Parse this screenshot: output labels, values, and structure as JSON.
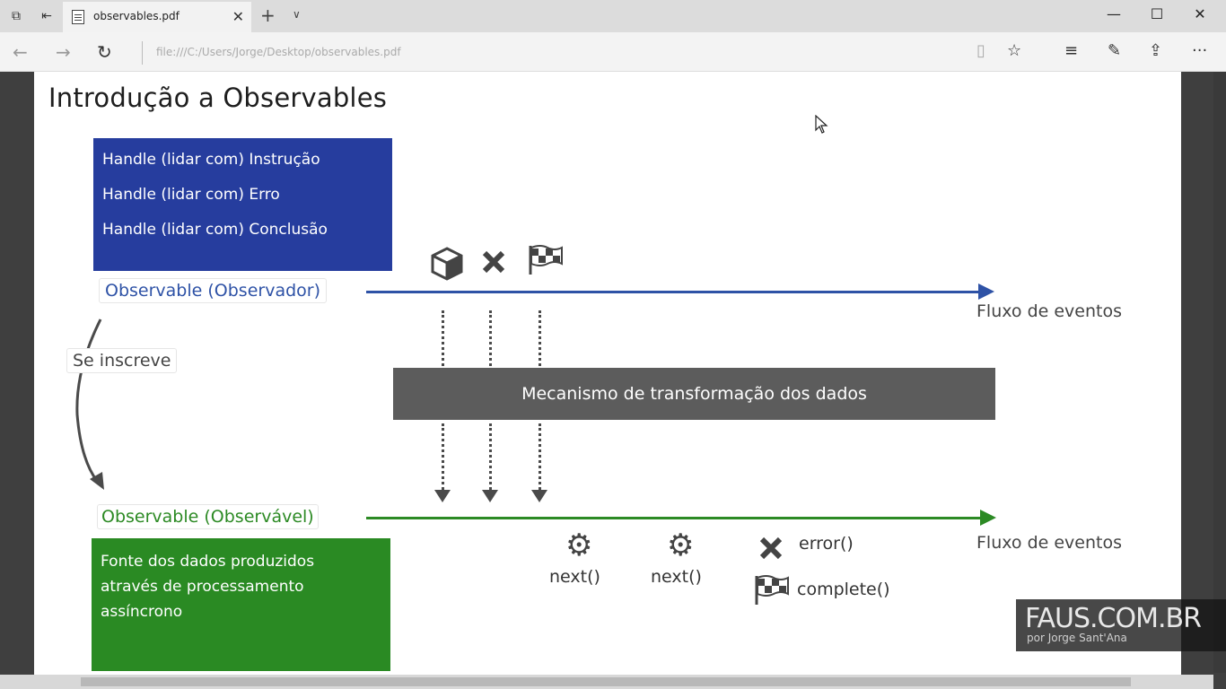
{
  "browser": {
    "tab_title": "observables.pdf",
    "tab_close": "✕",
    "new_tab": "+",
    "tab_list": "∨",
    "url": "file:///C:/Users/Jorge/Desktop/observables.pdf",
    "window_minimize": "—",
    "window_maximize": "☐",
    "window_close": "✕"
  },
  "slide": {
    "title": "Introdução a Observables",
    "observer_box": {
      "lines": [
        "Handle (lidar com) Instrução",
        "Handle (lidar com) Erro",
        "Handle (lidar com) Conclusão"
      ],
      "color": "#263d9e"
    },
    "observer_label": "Observable (Observador)",
    "subscribe_label": "Se inscreve",
    "observable_label": "Observable (Observável)",
    "source_box": {
      "lines": [
        "Fonte dos dados produzidos",
        "através de processamento",
        "assíncrono"
      ],
      "color": "#2a8a23"
    },
    "flow_label_top": "Fluxo de eventos",
    "flow_label_bottom": "Fluxo de eventos",
    "mechanism": "Mecanismo de transformação dos dados",
    "events": {
      "next_1": "next()",
      "next_2": "next()",
      "error": "error()",
      "complete": "complete()"
    },
    "colors": {
      "observer_line": "#2e52a6",
      "observable_line": "#2c8a24",
      "mechanism_bg": "#5c5c5c"
    }
  },
  "watermark": {
    "main": "FAUS.COM.BR",
    "sub": "por Jorge Sant'Ana"
  }
}
